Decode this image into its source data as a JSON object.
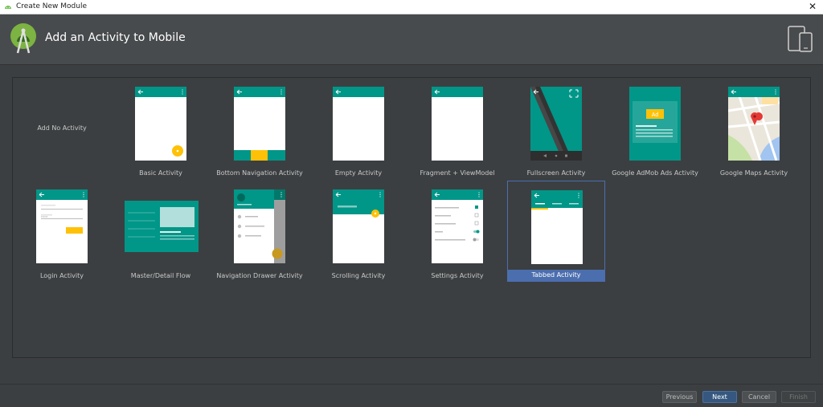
{
  "window": {
    "title": "Create New Module",
    "close_glyph": "✕"
  },
  "header": {
    "title": "Add an Activity to Mobile",
    "logo_icon": "android-studio-logo",
    "device_icon": "phone-tablet-icon"
  },
  "colors": {
    "teal": "#009688",
    "teal_dark": "#00796b",
    "amber": "#ffc107",
    "selection": "#4b6eaf",
    "background": "#3c3f41"
  },
  "activities": [
    {
      "label": "Add No Activity"
    },
    {
      "label": "Basic Activity"
    },
    {
      "label": "Bottom Navigation Activity"
    },
    {
      "label": "Empty Activity"
    },
    {
      "label": "Fragment + ViewModel"
    },
    {
      "label": "Fullscreen Activity"
    },
    {
      "label": "Google AdMob Ads Activity",
      "ad_badge": "Ad"
    },
    {
      "label": "Google Maps Activity"
    },
    {
      "label": "Login Activity"
    },
    {
      "label": "Master/Detail Flow"
    },
    {
      "label": "Navigation Drawer Activity"
    },
    {
      "label": "Scrolling Activity"
    },
    {
      "label": "Settings Activity"
    },
    {
      "label": "Tabbed Activity",
      "selected": true
    }
  ],
  "footer": {
    "previous": "Previous",
    "next": "Next",
    "cancel": "Cancel",
    "finish": "Finish"
  }
}
